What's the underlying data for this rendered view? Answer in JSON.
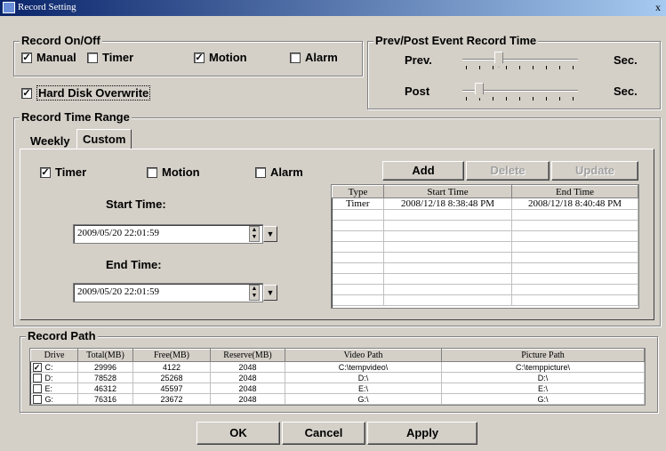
{
  "window": {
    "title": "Record Setting",
    "close": "x"
  },
  "record_onoff": {
    "title": "Record On/Off",
    "manual": {
      "label": "Manual",
      "checked": true
    },
    "timer": {
      "label": "Timer",
      "checked": false
    },
    "motion": {
      "label": "Motion",
      "checked": true
    },
    "alarm": {
      "label": "Alarm",
      "checked": false
    }
  },
  "hard_disk_overwrite": {
    "label": "Hard Disk Overwrite",
    "checked": true
  },
  "prevpost": {
    "title": "Prev/Post Event Record Time",
    "prev": {
      "label": "Prev.",
      "unit": "Sec.",
      "level": 0.3
    },
    "post": {
      "label": "Post",
      "unit": "Sec.",
      "level": 0.12
    }
  },
  "time_range": {
    "title": "Record Time Range",
    "tabs": [
      "Weekly",
      "Custom"
    ],
    "active_tab": "Custom",
    "timer": {
      "label": "Timer",
      "checked": true
    },
    "motion": {
      "label": "Motion",
      "checked": false
    },
    "alarm": {
      "label": "Alarm",
      "checked": false
    },
    "start_label": "Start Time:",
    "start_value": "2009/05/20 22:01:59",
    "end_label": "End Time:",
    "end_value": "2009/05/20 22:01:59",
    "buttons": {
      "add": "Add",
      "delete": "Delete",
      "update": "Update"
    },
    "table": {
      "headers": [
        "Type",
        "Start Time",
        "End Time"
      ],
      "rows": [
        [
          "Timer",
          "2008/12/18 8:38:48 PM",
          "2008/12/18 8:40:48 PM"
        ]
      ]
    }
  },
  "record_path": {
    "title": "Record Path",
    "headers": [
      "Drive",
      "Total(MB)",
      "Free(MB)",
      "Reserve(MB)",
      "Video Path",
      "Picture Path"
    ],
    "rows": [
      {
        "checked": true,
        "drive": "C:",
        "total": "29996",
        "free": "4122",
        "reserve": "2048",
        "video": "C:\\tempvideo\\",
        "picture": "C:\\temppicture\\"
      },
      {
        "checked": false,
        "drive": "D:",
        "total": "78528",
        "free": "25268",
        "reserve": "2048",
        "video": "D:\\",
        "picture": "D:\\"
      },
      {
        "checked": false,
        "drive": "E:",
        "total": "46312",
        "free": "45597",
        "reserve": "2048",
        "video": "E:\\",
        "picture": "E:\\"
      },
      {
        "checked": false,
        "drive": "G:",
        "total": "76316",
        "free": "23672",
        "reserve": "2048",
        "video": "G:\\",
        "picture": "G:\\"
      }
    ]
  },
  "footer": {
    "ok": "OK",
    "cancel": "Cancel",
    "apply": "Apply"
  }
}
